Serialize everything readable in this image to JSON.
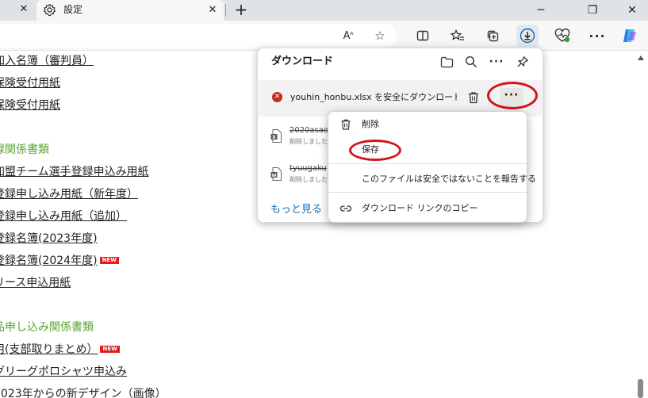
{
  "browser": {
    "tab_title": "設定",
    "toolbar_icons": [
      "read-aloud-icon",
      "favorite-star-icon",
      "split-screen-icon",
      "favorites-icon",
      "collections-icon",
      "download-icon",
      "browser-essentials-icon",
      "more-icon",
      "copilot-icon"
    ]
  },
  "page": {
    "lines": [
      {
        "text": "加入名簿（審判員）",
        "kind": "link",
        "new": false
      },
      {
        "text": "保険受付用紙",
        "kind": "link",
        "new": false
      },
      {
        "text": "保険受付用紙",
        "kind": "link",
        "new": false
      },
      {
        "text": "録関係書類",
        "kind": "heading",
        "new": false
      },
      {
        "text": "加盟チーム選手登録申込み用紙",
        "kind": "link",
        "new": false
      },
      {
        "text": "登録申し込み用紙（新年度）",
        "kind": "link",
        "new": false
      },
      {
        "text": "登録申し込み用紙（追加）",
        "kind": "link",
        "new": false
      },
      {
        "text": "登録名簿(2023年度)",
        "kind": "link",
        "new": false
      },
      {
        "text": "登録名簿(2024年度)",
        "kind": "link",
        "new": true
      },
      {
        "text": "リース申込用紙",
        "kind": "link",
        "new": false
      },
      {
        "text": "品申し込み関係書類",
        "kind": "heading",
        "new": false
      },
      {
        "text": "用(支部取りまとめ）",
        "kind": "link",
        "new": true
      },
      {
        "text": "グリーグポロシャツ申込み",
        "kind": "link",
        "new": false
      },
      {
        "text": "2023年からの新デザイン（画像）",
        "kind": "link",
        "new": false
      }
    ],
    "new_badge": "NEW"
  },
  "downloads": {
    "title": "ダウンロード",
    "items": [
      {
        "filename": "youhin_honbu.xlsx を安全にダウンロードすることはできません",
        "status": "error"
      },
      {
        "filename": "2020asao",
        "sub": "削除しました"
      },
      {
        "filename": "tyuugaku",
        "sub": "削除しました"
      }
    ],
    "more_link": "もっと見る",
    "more_button": "···"
  },
  "context_menu": {
    "items": [
      {
        "label": "削除",
        "icon": "trash-icon"
      },
      {
        "label": "保存",
        "icon": ""
      },
      {
        "label": "このファイルは安全ではないことを報告する",
        "icon": ""
      },
      {
        "label": "ダウンロード リンクのコピー",
        "icon": "link-icon"
      }
    ]
  },
  "colors": {
    "heading_green": "#5aa531",
    "highlight_red": "#d3141c",
    "link_blue": "#0f6cbd",
    "error_red": "#c42b1c"
  }
}
